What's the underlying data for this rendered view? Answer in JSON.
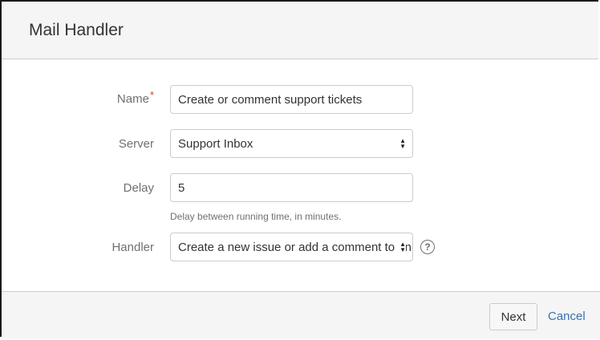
{
  "dialog": {
    "title": "Mail Handler"
  },
  "form": {
    "name": {
      "label": "Name",
      "required_mark": "*",
      "value": "Create or comment support tickets"
    },
    "server": {
      "label": "Server",
      "selected": "Support Inbox"
    },
    "delay": {
      "label": "Delay",
      "value": "5",
      "help": "Delay between running time, in minutes."
    },
    "handler": {
      "label": "Handler",
      "selected": "Create a new issue or add a comment to an existing issue",
      "help_icon": "question-circle-icon"
    }
  },
  "footer": {
    "next_label": "Next",
    "cancel_label": "Cancel"
  },
  "colors": {
    "link": "#3572b0",
    "required": "#d04437"
  }
}
